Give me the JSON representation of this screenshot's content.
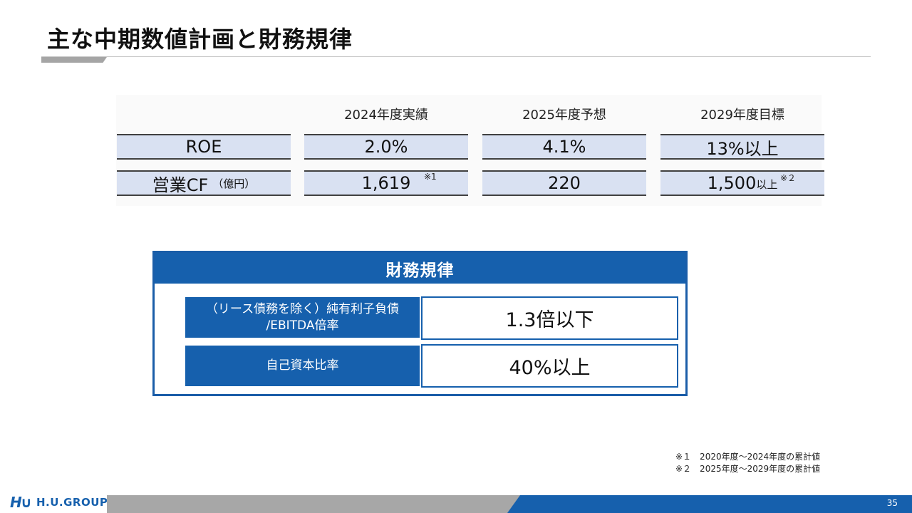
{
  "title": "主な中期数値計画と財務規律",
  "kpi_table": {
    "columns": [
      "2024年度実績",
      "2025年度予想",
      "2029年度目標"
    ],
    "rows": [
      {
        "label": "ROE",
        "label_unit": "",
        "values": [
          "2.0%",
          "4.1%",
          "13%以上"
        ]
      },
      {
        "label": "営業CF",
        "label_unit": "（億円）",
        "values": [
          "1,619",
          "220",
          "1,500"
        ]
      }
    ],
    "note_1": "※1",
    "note_2": "※２",
    "value_suffix": "以上"
  },
  "financial_discipline": {
    "header": "財務規律",
    "rows": [
      {
        "label_line1": "（リース債務を除く）純有利子負債",
        "label_line2": "/EBITDA倍率",
        "value": "1.3倍以下"
      },
      {
        "label_line1": "自己資本比率",
        "label_line2": "",
        "value": "40%以上"
      }
    ]
  },
  "footnotes": [
    "※１　2020年度～2024年度の累計値",
    "※２　2025年度～2029年度の累計値"
  ],
  "footer": {
    "logo_mark": "H∪",
    "logo_text": "H.U.GROUP",
    "page_number": "35"
  },
  "colors": {
    "accent_blue": "#1660ad",
    "cell_fill": "#d9e1f2",
    "footer_gray": "#a7a7a7"
  }
}
